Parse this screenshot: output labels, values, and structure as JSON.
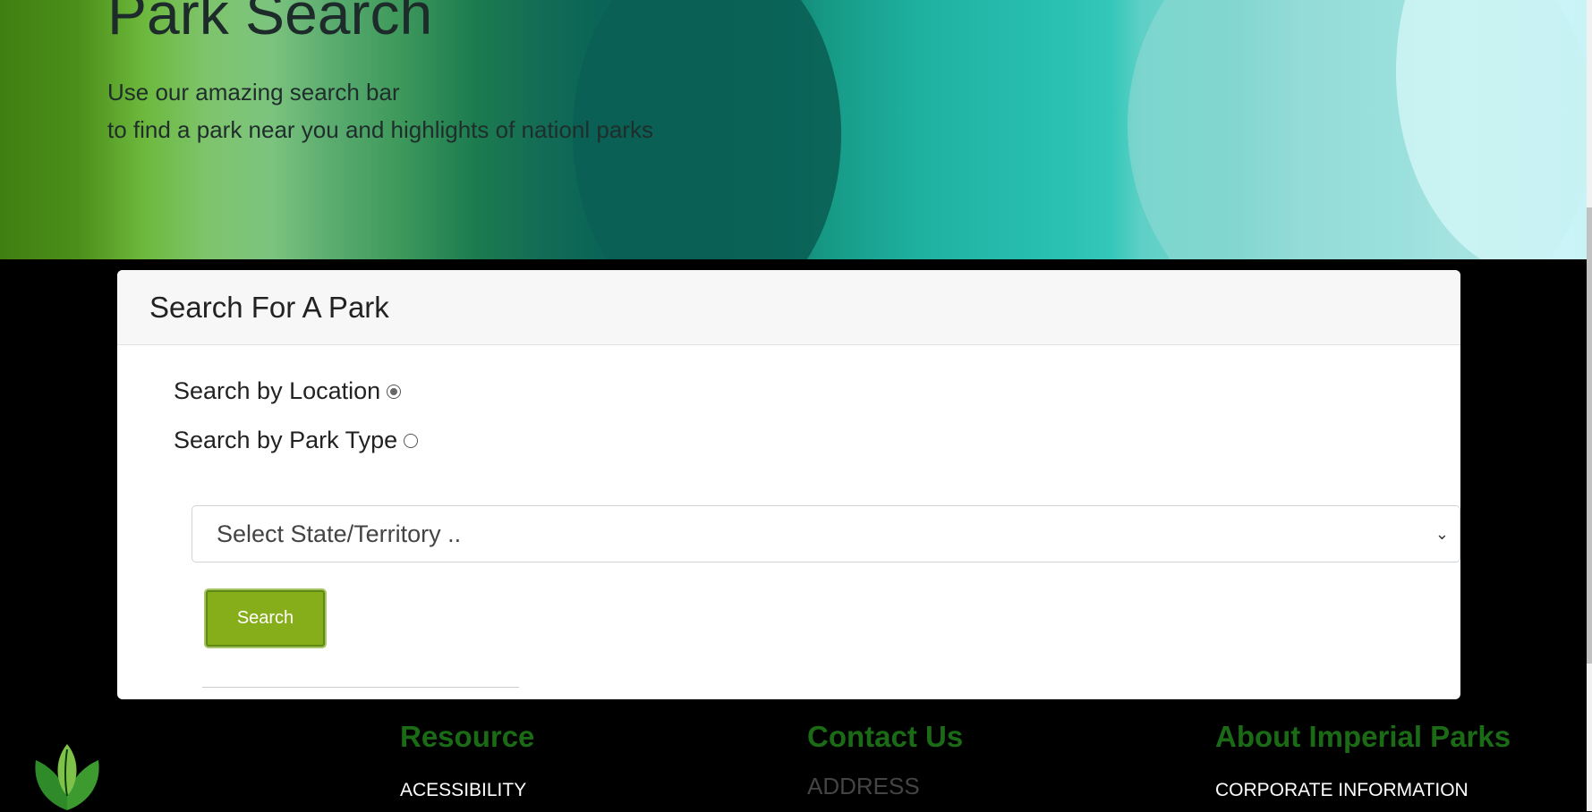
{
  "hero": {
    "title": "Park Search",
    "subtitle_line1": "Use our amazing search bar",
    "subtitle_line2": "to find a park near you and highlights of nationl parks"
  },
  "card": {
    "title": "Search For A Park",
    "radio_location_label": "Search by Location",
    "radio_location_checked": true,
    "radio_parktype_label": "Search by Park Type",
    "radio_parktype_checked": false,
    "select_placeholder": "Select State/Territory ..",
    "search_button": "Search"
  },
  "footer": {
    "resource_heading": "Resource",
    "resource_link": "ACESSIBILITY",
    "contact_heading": "Contact Us",
    "contact_text": "ADDRESS",
    "about_heading": "About Imperial Parks",
    "about_link": "CORPORATE INFORMATION"
  },
  "colors": {
    "button": "#86ad1a",
    "footer_heading": "#1b6b16"
  }
}
